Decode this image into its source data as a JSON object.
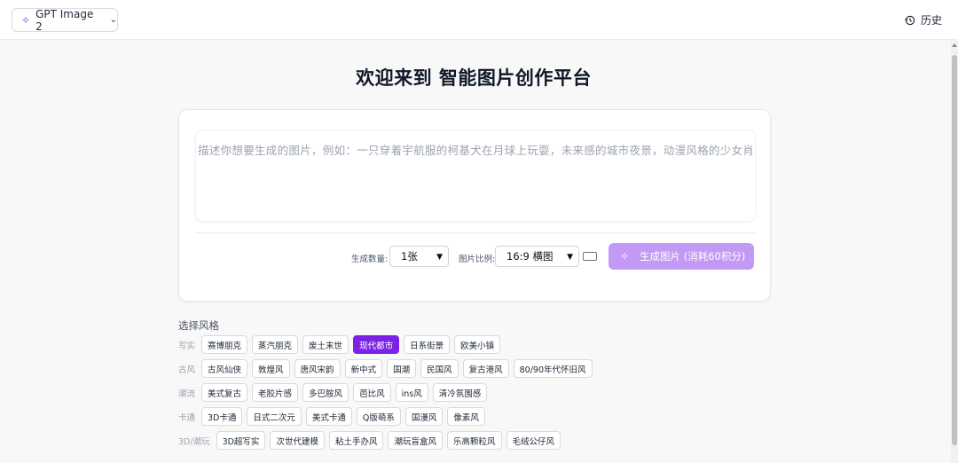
{
  "header": {
    "model_label": "GPT Image 2",
    "history_label": "历史"
  },
  "main": {
    "title": "欢迎来到 智能图片创作平台",
    "prompt_placeholder": "描述你想要生成的图片，例如：一只穿着宇航服的柯基犬在月球上玩耍，未来感的城市夜景，动漫风格的少女肖像...",
    "count_label": "生成数量:",
    "count_value": "1张",
    "ratio_label": "图片比例:",
    "ratio_value": "16:9 横图",
    "generate_label": "生成图片 (消耗60积分)"
  },
  "styles": {
    "section_title": "选择风格",
    "rows": [
      {
        "label": "写实",
        "items": [
          "赛博朋克",
          "蒸汽朋克",
          "废土末世",
          "现代都市",
          "日系街景",
          "欧美小镇"
        ],
        "selected": 3
      },
      {
        "label": "古风",
        "items": [
          "古风仙侠",
          "敦煌风",
          "唐风宋韵",
          "新中式",
          "国潮",
          "民国风",
          "复古港风",
          "80/90年代怀旧风"
        ],
        "selected": -1
      },
      {
        "label": "潮流",
        "items": [
          "美式复古",
          "老胶片感",
          "多巴胺风",
          "芭比风",
          "ins风",
          "清冷氛围感"
        ],
        "selected": -1
      },
      {
        "label": "卡通",
        "items": [
          "3D卡通",
          "日式二次元",
          "美式卡通",
          "Q版萌系",
          "国漫风",
          "像素风"
        ],
        "selected": -1
      },
      {
        "label": "3D/潮玩",
        "items": [
          "3D超写实",
          "次世代建模",
          "粘土手办风",
          "潮玩盲盒风",
          "乐高颗粒风",
          "毛绒公仔风"
        ],
        "selected": -1
      }
    ]
  },
  "colors": {
    "accent": "#7c22e6",
    "button_disabled": "#c299f5"
  }
}
